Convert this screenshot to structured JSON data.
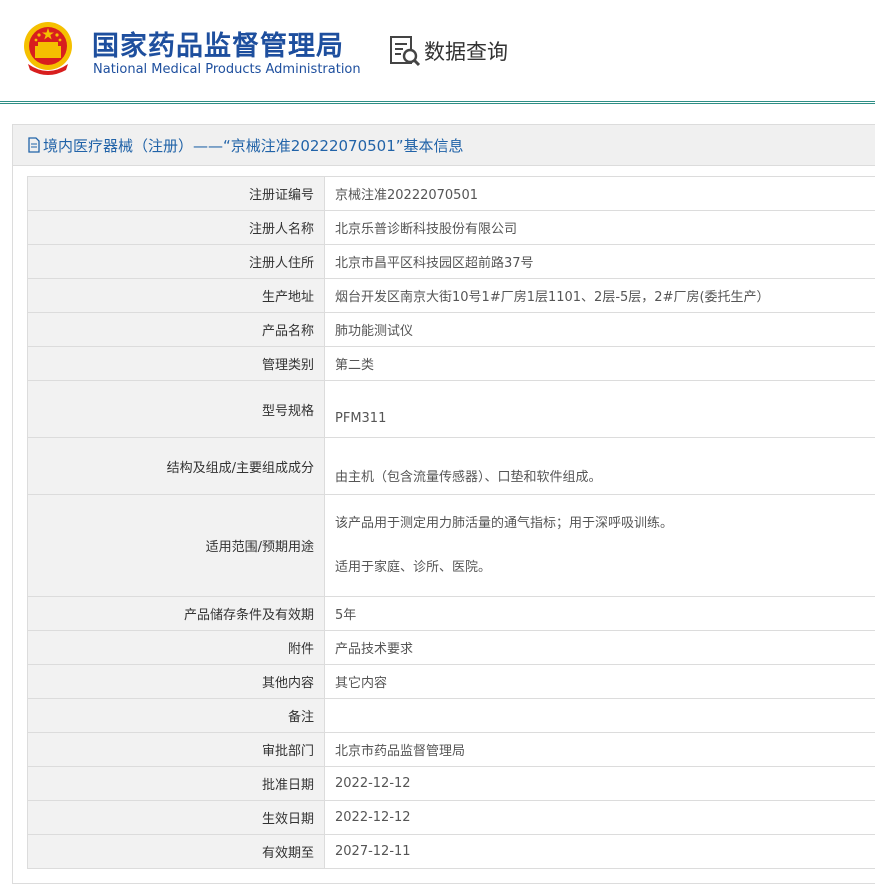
{
  "header": {
    "org_name_cn": "国家药品监督管理局",
    "org_name_en": "National Medical Products Administration",
    "query_label": "数据查询"
  },
  "panel": {
    "title": "境内医疗器械（注册）——“京械注准20222070501”基本信息"
  },
  "rows": [
    {
      "label": "注册证编号",
      "value": "京械注准20222070501"
    },
    {
      "label": "注册人名称",
      "value": "北京乐普诊断科技股份有限公司"
    },
    {
      "label": "注册人住所",
      "value": "北京市昌平区科技园区超前路37号"
    },
    {
      "label": "生产地址",
      "value": "烟台开发区南京大街10号1#厂房1层1101、2层-5层，2#厂房(委托生产）"
    },
    {
      "label": "产品名称",
      "value": "肺功能测试仪"
    },
    {
      "label": "管理类别",
      "value": "第二类"
    },
    {
      "label": "型号规格",
      "value": "PFM311"
    },
    {
      "label": "结构及组成/主要组成成分",
      "value": "由主机（包含流量传感器）、口垫和软件组成。"
    },
    {
      "label": "适用范围/预期用途",
      "value_line1": "该产品用于测定用力肺活量的通气指标；用于深呼吸训练。",
      "value_line2": "适用于家庭、诊所、医院。"
    },
    {
      "label": "产品储存条件及有效期",
      "value": "5年"
    },
    {
      "label": "附件",
      "value": "产品技术要求"
    },
    {
      "label": "其他内容",
      "value": "其它内容"
    },
    {
      "label": "备注",
      "value": ""
    },
    {
      "label": "审批部门",
      "value": "北京市药品监督管理局"
    },
    {
      "label": "批准日期",
      "value": "2022-12-12"
    },
    {
      "label": "生效日期",
      "value": "2022-12-12"
    },
    {
      "label": "有效期至",
      "value": "2027-12-11"
    }
  ],
  "colors": {
    "brand_blue": "#1e4f9e",
    "title_blue": "#2163a8",
    "divider_teal": "#2f8f86",
    "emblem_red": "#d81e1e",
    "emblem_gold": "#f5c000"
  },
  "icons": [
    "national-emblem-icon",
    "data-query-icon",
    "document-icon"
  ]
}
